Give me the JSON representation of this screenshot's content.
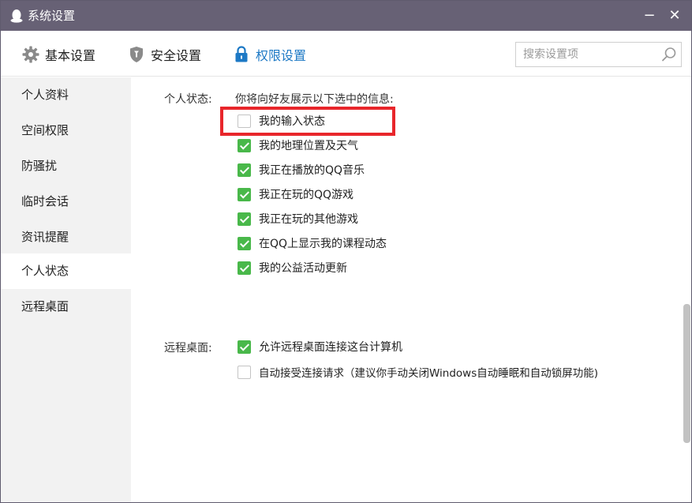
{
  "window": {
    "title": "系统设置",
    "minimize": "−",
    "close": "✕",
    "icon": "qq-penguin-icon"
  },
  "tabs": [
    {
      "label": "基本设置",
      "icon": "gear-icon",
      "active": false
    },
    {
      "label": "安全设置",
      "icon": "shield-icon",
      "active": false
    },
    {
      "label": "权限设置",
      "icon": "lock-icon",
      "active": true
    }
  ],
  "search": {
    "placeholder": "搜索设置项",
    "value": "",
    "icon": "search-icon"
  },
  "sidebar": {
    "items": [
      {
        "label": "个人资料",
        "active": false
      },
      {
        "label": "空间权限",
        "active": false
      },
      {
        "label": "防骚扰",
        "active": false
      },
      {
        "label": "临时会话",
        "active": false
      },
      {
        "label": "资讯提醒",
        "active": false
      },
      {
        "label": "个人状态",
        "active": true
      },
      {
        "label": "远程桌面",
        "active": false
      }
    ]
  },
  "personal_status": {
    "label": "个人状态:",
    "description": "你将向好友展示以下选中的信息:",
    "options": [
      {
        "label": "我的输入状态",
        "checked": false
      },
      {
        "label": "我的地理位置及天气",
        "checked": true
      },
      {
        "label": "我正在播放的QQ音乐",
        "checked": true
      },
      {
        "label": "我正在玩的QQ游戏",
        "checked": true
      },
      {
        "label": "我正在玩的其他游戏",
        "checked": true
      },
      {
        "label": "在QQ上显示我的课程动态",
        "checked": true
      },
      {
        "label": "我的公益活动更新",
        "checked": true
      }
    ]
  },
  "remote_desktop": {
    "label": "远程桌面:",
    "options": [
      {
        "label": "允许远程桌面连接这台计算机",
        "checked": true
      },
      {
        "label": "自动接受连接请求（建议你手动关闭Windows自动睡眠和自动锁屏功能)",
        "checked": false
      }
    ]
  },
  "colors": {
    "titlebar": "#676175",
    "accent": "#1d79c5",
    "checkbox_checked": "#49b84a",
    "highlight": "#e8262b"
  }
}
